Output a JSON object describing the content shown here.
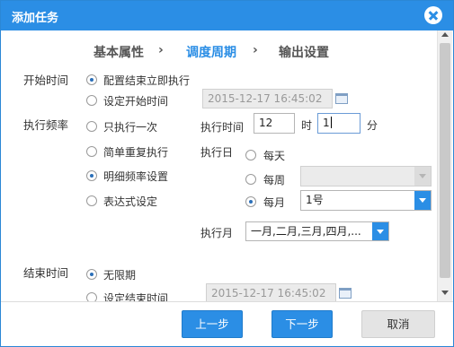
{
  "dialog": {
    "title": "添加任务"
  },
  "steps": [
    "基本属性",
    "调度周期",
    "输出设置"
  ],
  "step_separator": "›",
  "active_step": "调度周期",
  "start_time": {
    "label": "开始时间",
    "options": [
      "配置结束立即执行",
      "设定开始时间"
    ],
    "selected": "配置结束立即执行",
    "datetime_value": "2015-12-17 16:45:02"
  },
  "frequency": {
    "label": "执行频率",
    "options": [
      "只执行一次",
      "简单重复执行",
      "明细频率设置",
      "表达式设定"
    ],
    "selected": "明细频率设置",
    "exec_time_label": "执行时间",
    "hour_value": "12",
    "hour_unit": "时",
    "minute_value": "1",
    "minute_unit": "分",
    "exec_day_label": "执行日",
    "day_options": [
      "每天",
      "每周",
      "每月"
    ],
    "day_selected": "每月",
    "weekly_value": "",
    "monthly_value": "1号",
    "exec_month_label": "执行月",
    "months_value": "一月,二月,三月,四月,..."
  },
  "end_time": {
    "label": "结束时间",
    "options": [
      "无限期",
      "设定结束时间"
    ],
    "selected": "无限期",
    "datetime_value": "2015-12-17 16:45:02"
  },
  "buttons": {
    "prev": "上一步",
    "next": "下一步",
    "cancel": "取消"
  },
  "colors": {
    "accent": "#2b8ee5",
    "disabled_bg": "#ebebeb"
  }
}
